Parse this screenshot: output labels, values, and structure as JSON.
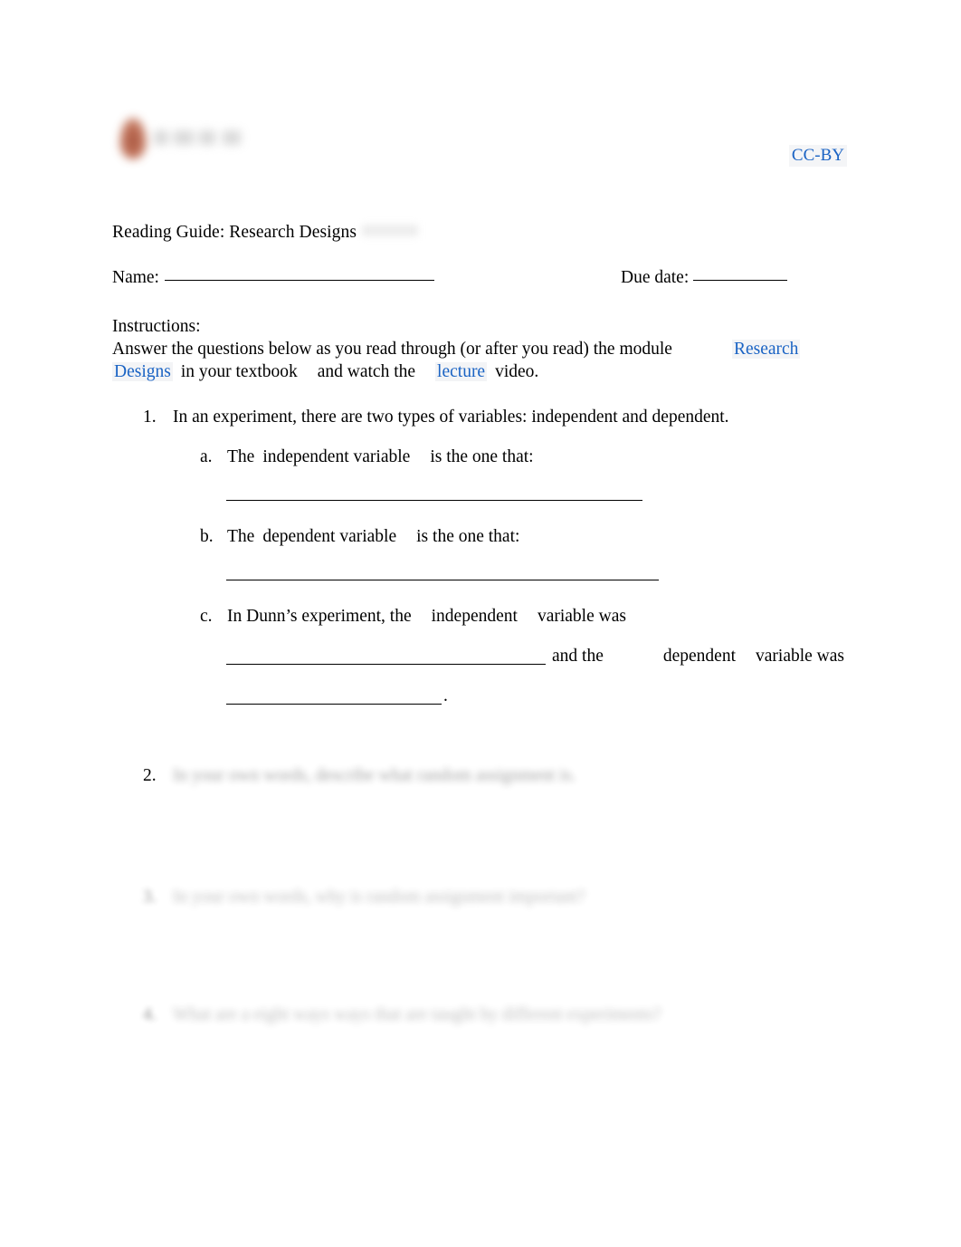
{
  "document": {
    "title": "Reading Guide: Research Designs",
    "title_redacted_suffix": "[redacted]"
  },
  "header": {
    "logo_name": "institution-logo",
    "license_label": "CC-BY"
  },
  "fields": {
    "name_label": "Name:",
    "due_date_label": "Due date:"
  },
  "instructions": {
    "heading": "Instructions:",
    "line2_before": "Answer the questions below as you read through (or after you read) the module",
    "link_research": "Research",
    "link_designs": "Designs",
    "line3_mid": "in your textbook",
    "line3_and": "and watch the",
    "link_lecture": "lecture",
    "line3_end": "video."
  },
  "questions": [
    {
      "number": "1.",
      "text": "In an experiment, there are two types of variables: independent and dependent.",
      "subitems": [
        {
          "label": "a.",
          "prefix": "The",
          "term": "independent variable",
          "suffix": "is the one that:"
        },
        {
          "label": "b.",
          "prefix": "The",
          "term": "dependent variable",
          "suffix": "is the one that:"
        },
        {
          "label": "c.",
          "line1_prefix": "In Dunn’s experiment, the",
          "line1_term": "independent",
          "line1_suffix": "variable was",
          "line2_mid": "and the",
          "line2_term": "dependent",
          "line2_suffix": "variable was",
          "line3_end": "."
        }
      ]
    },
    {
      "number": "2.",
      "text": "In your own words, describe what random assignment is.",
      "redacted": true
    },
    {
      "number": "3.",
      "text": "In your own words, why is random assignment important?",
      "redacted": true
    },
    {
      "number": "4.",
      "text": "What are a eight ways ways that are taught by different experiments?",
      "redacted": true
    }
  ],
  "colors": {
    "link": "#1a63c4",
    "text": "#000000",
    "page_background": "#ffffff",
    "link_highlight": "#f3f4f6",
    "logo_accent": "#a8452a"
  }
}
